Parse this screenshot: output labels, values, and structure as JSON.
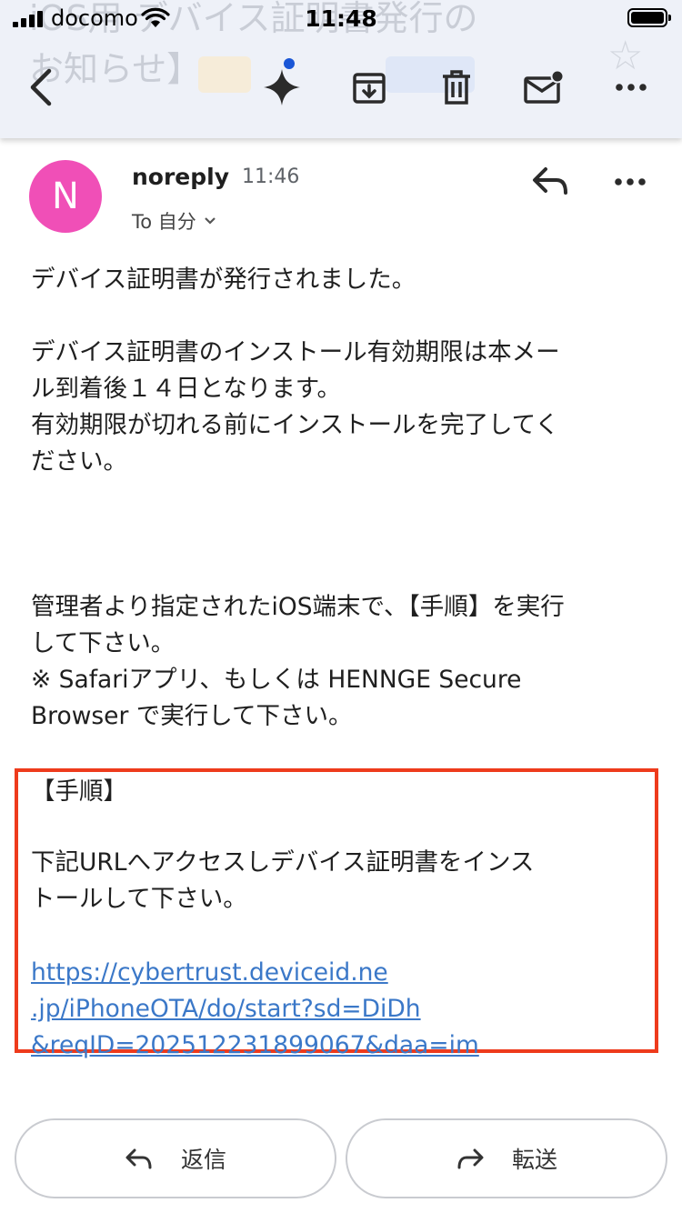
{
  "status_bar": {
    "carrier": "docomo",
    "time": "11:48"
  },
  "header": {
    "subject_behind": "iOS用 デバイス証明書発行の\nお知らせ】",
    "actions": [
      "back",
      "gemini",
      "archive",
      "delete",
      "mark-unread",
      "more"
    ]
  },
  "sender": {
    "initial": "N",
    "name": "noreply",
    "time": "11:46",
    "to": "To 自分"
  },
  "body": {
    "p1": "デバイス証明書が発行されました。",
    "p2": "デバイス証明書のインストール有効期限は本メー\nル到着後１４日となります。\n有効期限が切れる前にインストールを完了してく\nださい。",
    "p3": "管理者より指定されたiOS端末で、【手順】を実行\nして下さい。\n※ Safariアプリ、もしくは HENNGE Secure\nBrowser で実行して下さい。",
    "procedure_title": "【手順】",
    "procedure_text": "下記URLへアクセスしデバイス証明書をインス\nトールして下さい。",
    "link": "https://cybertrust.deviceid.ne\n.jp/iPhoneOTA/do/start?sd=DiDh\n&reqID=202512231899067&daa=im"
  },
  "actions": {
    "reply": "返信",
    "forward": "転送"
  },
  "colors": {
    "avatar": "#f04fb7",
    "highlight_border": "#ee3b1c",
    "link": "#3b78c8"
  }
}
